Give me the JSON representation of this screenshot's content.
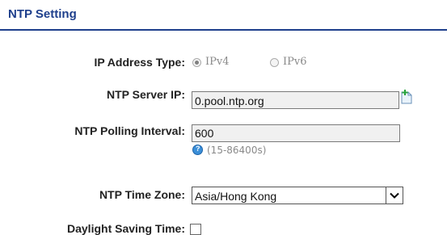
{
  "section": {
    "title": "NTP Setting"
  },
  "ip_address_type": {
    "label": "IP Address Type:",
    "options": [
      {
        "label": "IPv4",
        "selected": true
      },
      {
        "label": "IPv6",
        "selected": false
      }
    ]
  },
  "ntp_server_ip": {
    "label": "NTP Server IP:",
    "value": "0.pool.ntp.org",
    "add_icon": "add-document-icon"
  },
  "ntp_polling_interval": {
    "label": "NTP Polling Interval:",
    "value": "600",
    "hint": "(15-86400s)",
    "help_icon": "help-icon"
  },
  "ntp_time_zone": {
    "label": "NTP Time Zone:",
    "value": "Asia/Hong Kong",
    "dropdown_icon": "chevron-down-icon"
  },
  "daylight_saving_time": {
    "label": "Daylight Saving Time:",
    "checked": false
  },
  "colors": {
    "title": "#1e3f8c",
    "disabled_text": "#8a8a8a"
  }
}
